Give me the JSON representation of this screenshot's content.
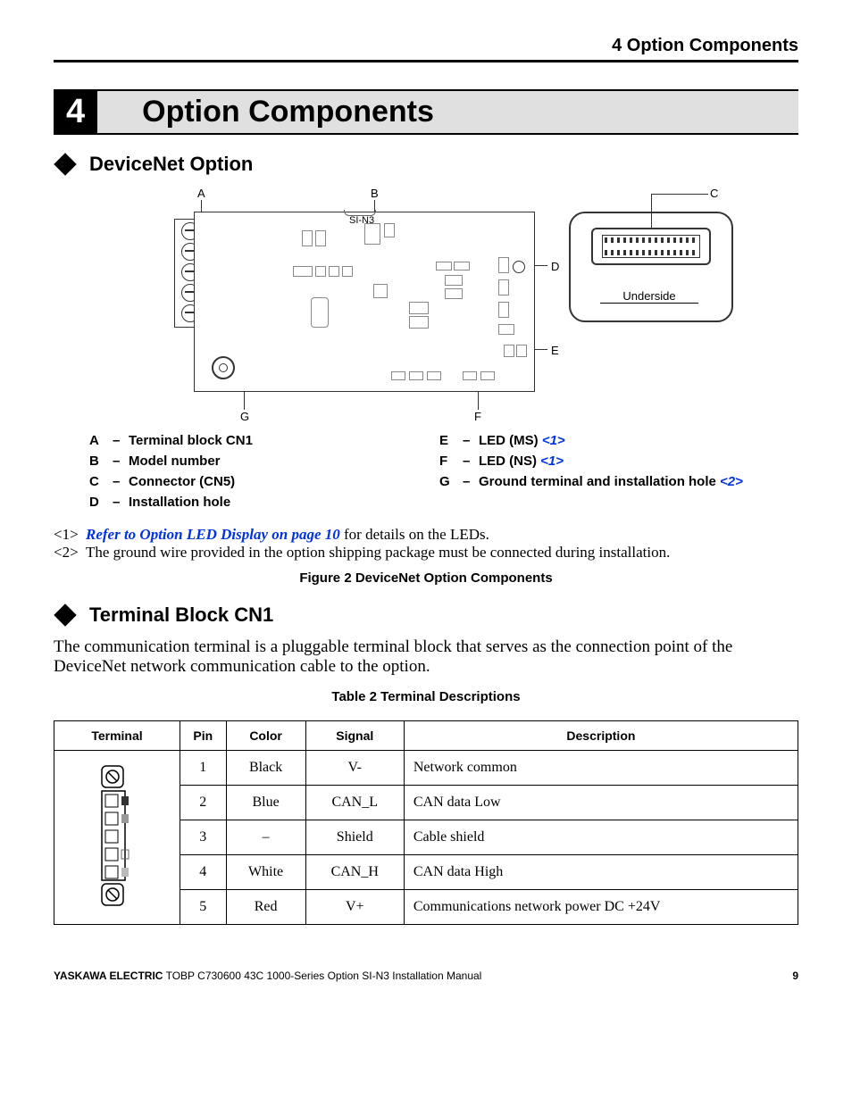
{
  "header": {
    "running": "4  Option Components"
  },
  "section": {
    "number": "4",
    "title": "Option Components"
  },
  "sub1": {
    "title": "DeviceNet Option"
  },
  "diagram": {
    "model_label": "SI-N3",
    "underside": "Underside",
    "labels": {
      "A": "A",
      "B": "B",
      "C": "C",
      "D": "D",
      "E": "E",
      "F": "F",
      "G": "G"
    }
  },
  "legend_left": [
    {
      "key": "A",
      "text": "Terminal block CN1"
    },
    {
      "key": "B",
      "text": "Model number"
    },
    {
      "key": "C",
      "text": "Connector (CN5)"
    },
    {
      "key": "D",
      "text": "Installation hole"
    }
  ],
  "legend_right": [
    {
      "key": "E",
      "text": "LED (MS) ",
      "ref": "<1>"
    },
    {
      "key": "F",
      "text": "LED (NS) ",
      "ref": "<1>"
    },
    {
      "key": "G",
      "text": "Ground terminal and installation hole  ",
      "ref": "<2>"
    }
  ],
  "notes": {
    "n1_tag": "<1>",
    "n1_link": "Refer to Option LED Display on page 10",
    "n1_rest": " for details on the LEDs.",
    "n2_tag": "<2>",
    "n2_text": "The ground wire provided in the option shipping package must be connected during installation."
  },
  "figure_caption": "Figure 2  DeviceNet Option Components",
  "sub2": {
    "title": "Terminal Block CN1"
  },
  "paragraph": "The communication terminal is a pluggable terminal block that serves as the connection point of the DeviceNet network communication cable to the option.",
  "table_caption": "Table 2  Terminal Descriptions",
  "chart_data": {
    "type": "table",
    "title": "Terminal Descriptions",
    "headers": [
      "Terminal",
      "Pin",
      "Color",
      "Signal",
      "Description"
    ],
    "rows": [
      {
        "pin": "1",
        "color": "Black",
        "signal": "V-",
        "description": "Network common"
      },
      {
        "pin": "2",
        "color": "Blue",
        "signal": "CAN_L",
        "description": "CAN data Low"
      },
      {
        "pin": "3",
        "color": "–",
        "signal": "Shield",
        "description": "Cable shield"
      },
      {
        "pin": "4",
        "color": "White",
        "signal": "CAN_H",
        "description": "CAN data High"
      },
      {
        "pin": "5",
        "color": "Red",
        "signal": "V+",
        "description": "Communications network power DC +24V"
      }
    ]
  },
  "footer": {
    "brand": "YASKAWA ELECTRIC",
    "doc": " TOBP C730600 43C 1000-Series Option SI-N3 Installation Manual",
    "page": "9"
  }
}
